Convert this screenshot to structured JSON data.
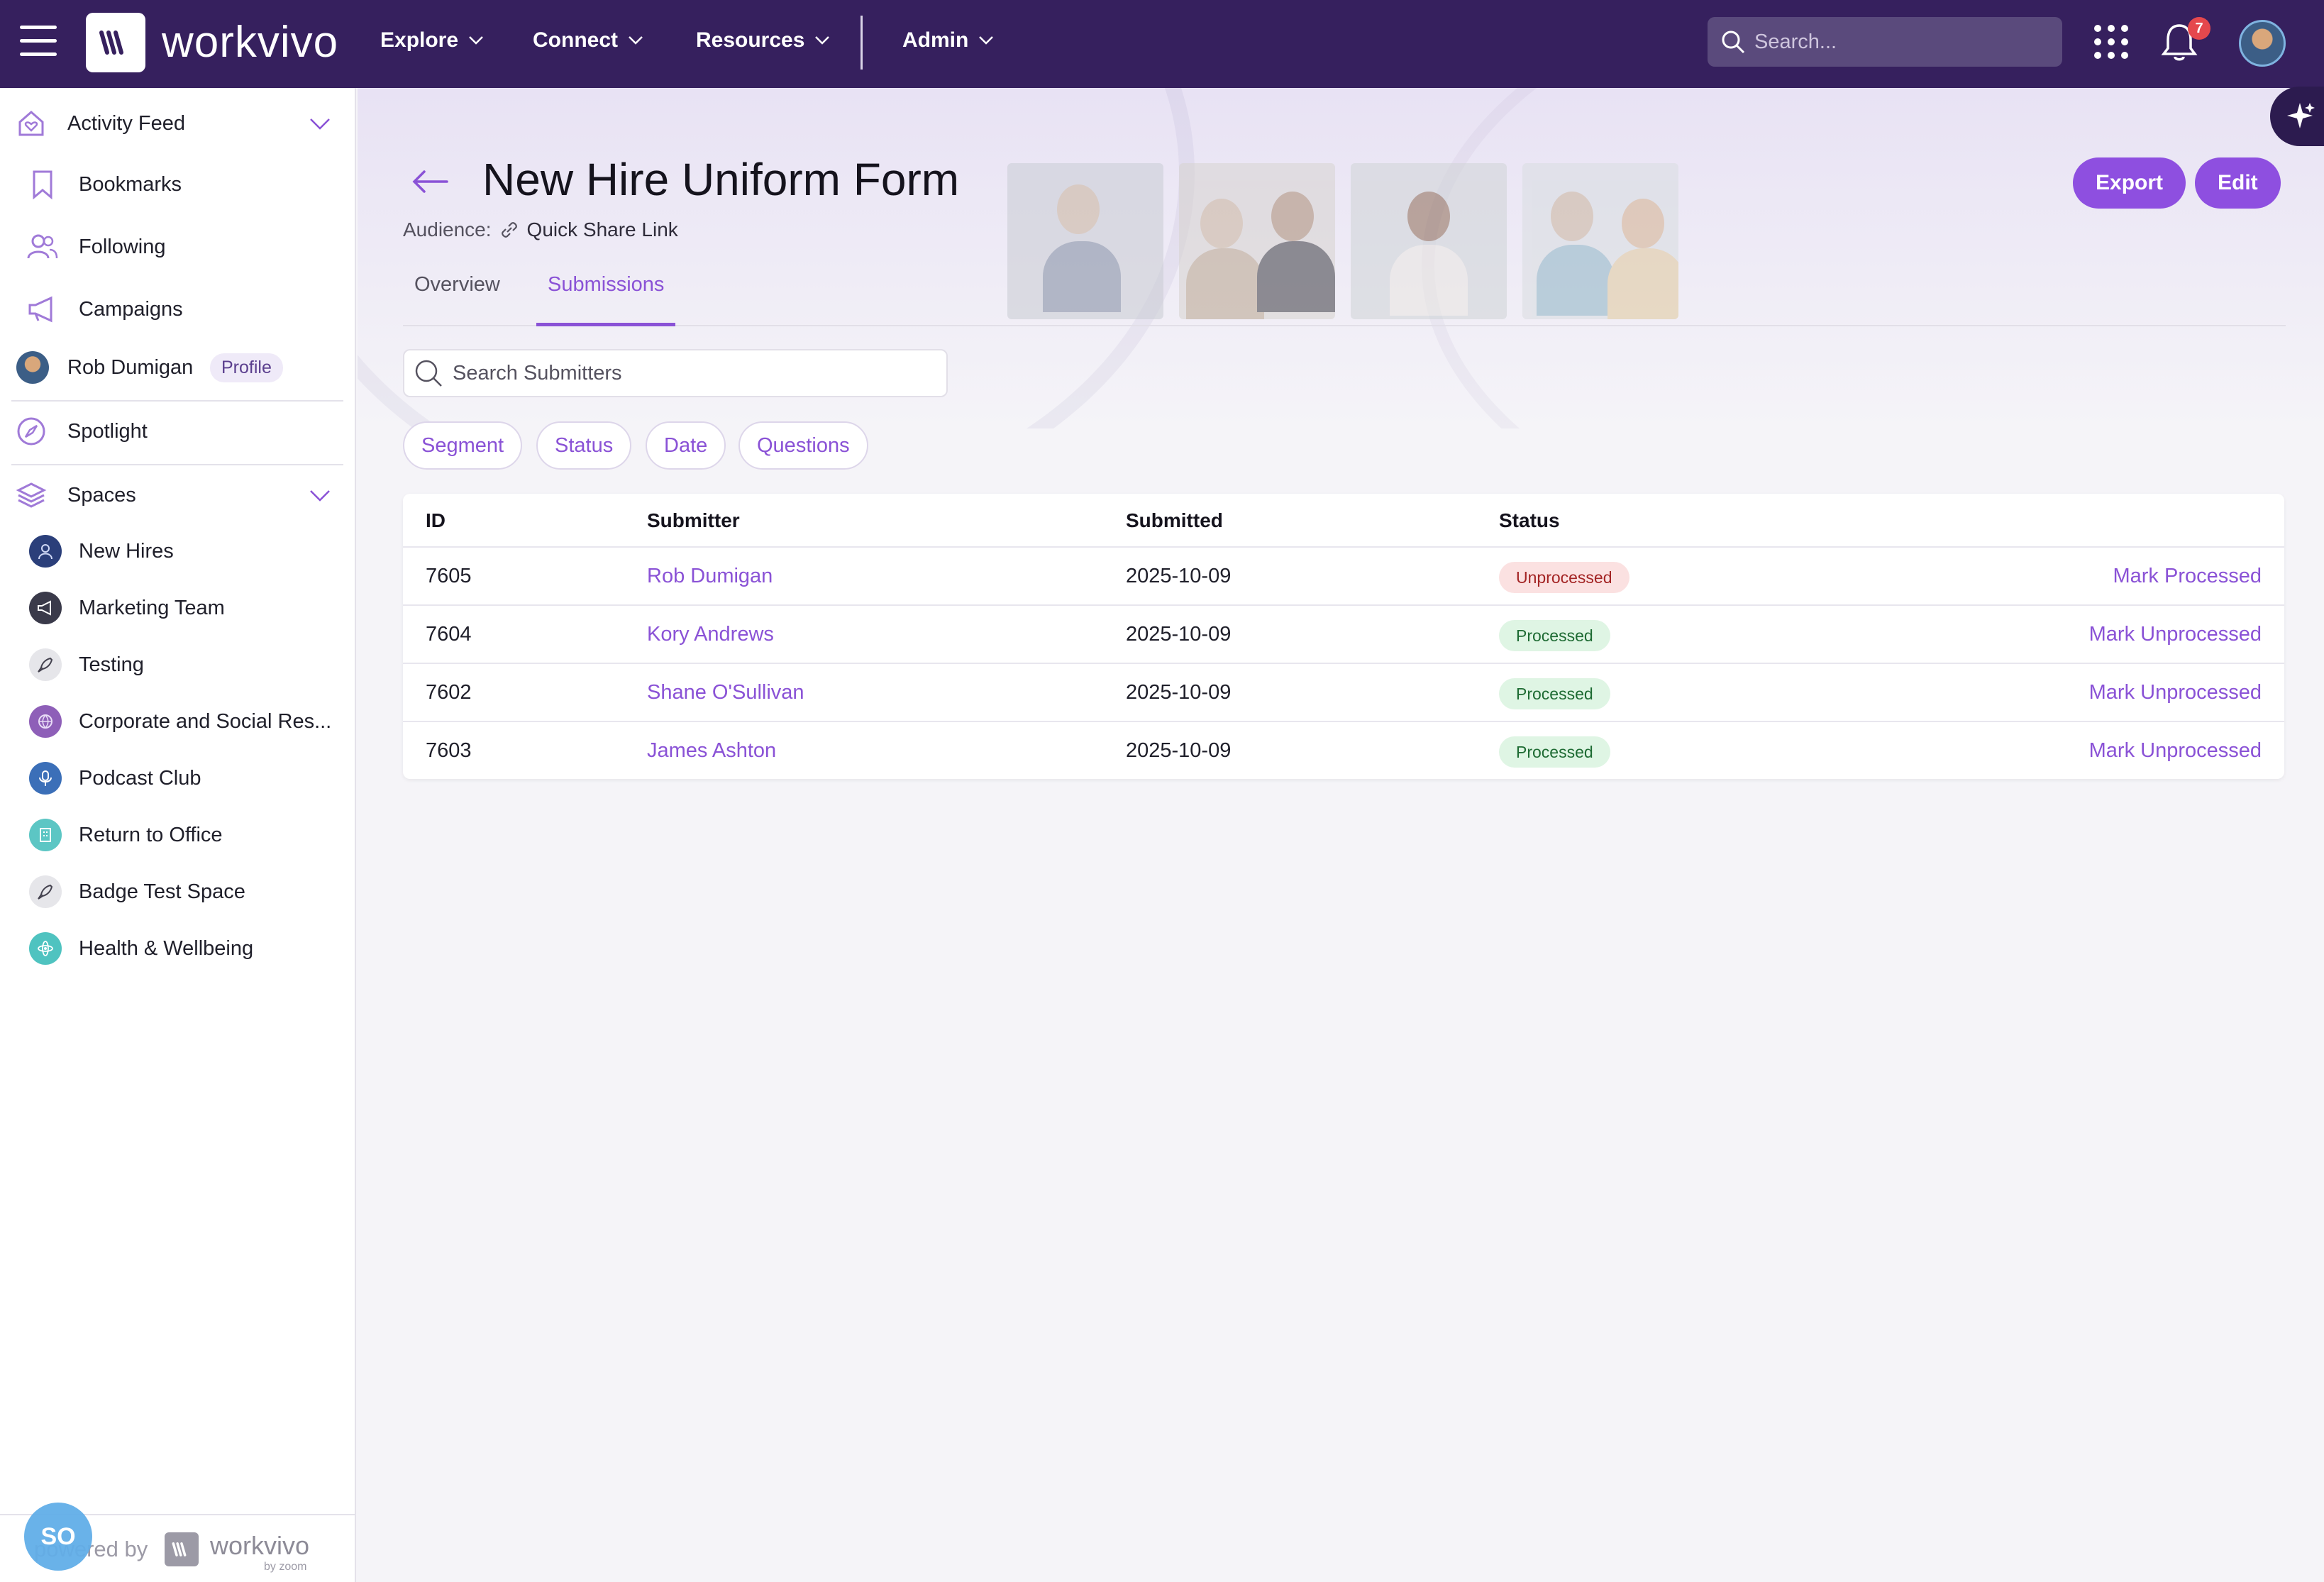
{
  "topbar": {
    "brand": "workvivo",
    "nav": [
      {
        "label": "Explore"
      },
      {
        "label": "Connect"
      },
      {
        "label": "Resources"
      },
      {
        "label": "Admin"
      }
    ],
    "search_placeholder": "Search...",
    "notification_count": "7",
    "accent": "#36205e"
  },
  "sidebar": {
    "activity_feed": "Activity Feed",
    "bookmarks": "Bookmarks",
    "following": "Following",
    "campaigns": "Campaigns",
    "user_name": "Rob Dumigan",
    "profile_label": "Profile",
    "spotlight": "Spotlight",
    "spaces": "Spaces",
    "space_items": [
      {
        "label": "New Hires",
        "color": "#2b3f7a",
        "icon": "user-icon"
      },
      {
        "label": "Marketing Team",
        "color": "#3a3a4a",
        "icon": "megaphone-icon"
      },
      {
        "label": "Testing",
        "color": "#e6e6ea",
        "icon": "rocket-icon"
      },
      {
        "label": "Corporate and Social Res...",
        "color": "#8e5fb8",
        "icon": "globe-icon"
      },
      {
        "label": "Podcast Club",
        "color": "#3b6fb8",
        "icon": "microphone-icon"
      },
      {
        "label": "Return to Office",
        "color": "#5cc6c4",
        "icon": "building-icon"
      },
      {
        "label": "Badge Test Space",
        "color": "#e6e6ea",
        "icon": "rocket-icon"
      },
      {
        "label": "Health & Wellbeing",
        "color": "#4fc3c0",
        "icon": "atom-icon"
      }
    ],
    "footer_initials": "SO",
    "powered_by": "powered by",
    "footer_brand": "workvivo",
    "footer_sub": "by zoom"
  },
  "page": {
    "title": "New Hire Uniform Form",
    "audience_label": "Audience:",
    "audience_value": "Quick Share Link",
    "export_label": "Export",
    "edit_label": "Edit",
    "tabs": [
      {
        "label": "Overview",
        "active": false
      },
      {
        "label": "Submissions",
        "active": true
      }
    ],
    "search_placeholder": "Search Submitters",
    "filters": [
      "Segment",
      "Status",
      "Date",
      "Questions"
    ]
  },
  "table": {
    "headers": [
      "ID",
      "Submitter",
      "Submitted",
      "Status"
    ],
    "rows": [
      {
        "id": "7605",
        "submitter": "Rob Dumigan",
        "submitted": "2025-10-09",
        "status": "Unprocessed",
        "action": "Mark Processed"
      },
      {
        "id": "7604",
        "submitter": "Kory Andrews",
        "submitted": "2025-10-09",
        "status": "Processed",
        "action": "Mark Unprocessed"
      },
      {
        "id": "7602",
        "submitter": "Shane O'Sullivan",
        "submitted": "2025-10-09",
        "status": "Processed",
        "action": "Mark Unprocessed"
      },
      {
        "id": "7603",
        "submitter": "James Ashton",
        "submitted": "2025-10-09",
        "status": "Processed",
        "action": "Mark Unprocessed"
      }
    ],
    "status_colors": {
      "Unprocessed": "#fbe1e1",
      "Processed": "#dff5e4"
    }
  }
}
